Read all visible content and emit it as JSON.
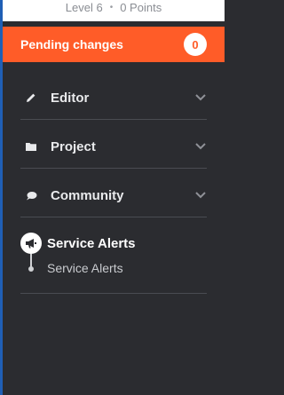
{
  "header": {
    "level": "Level 6",
    "separator": "•",
    "points": "0 Points"
  },
  "pending": {
    "label": "Pending changes",
    "count": "0"
  },
  "menu": {
    "items": [
      {
        "label": "Editor",
        "icon": "pencil-icon"
      },
      {
        "label": "Project",
        "icon": "folder-icon"
      },
      {
        "label": "Community",
        "icon": "chat-bubble-icon"
      }
    ]
  },
  "alerts": {
    "title": "Service Alerts",
    "sub_item": "Service Alerts",
    "icon": "megaphone-icon"
  },
  "colors": {
    "sidebar_bg": "#2b2c30",
    "accent": "#ff5c28",
    "edge": "#1f5fb5"
  }
}
